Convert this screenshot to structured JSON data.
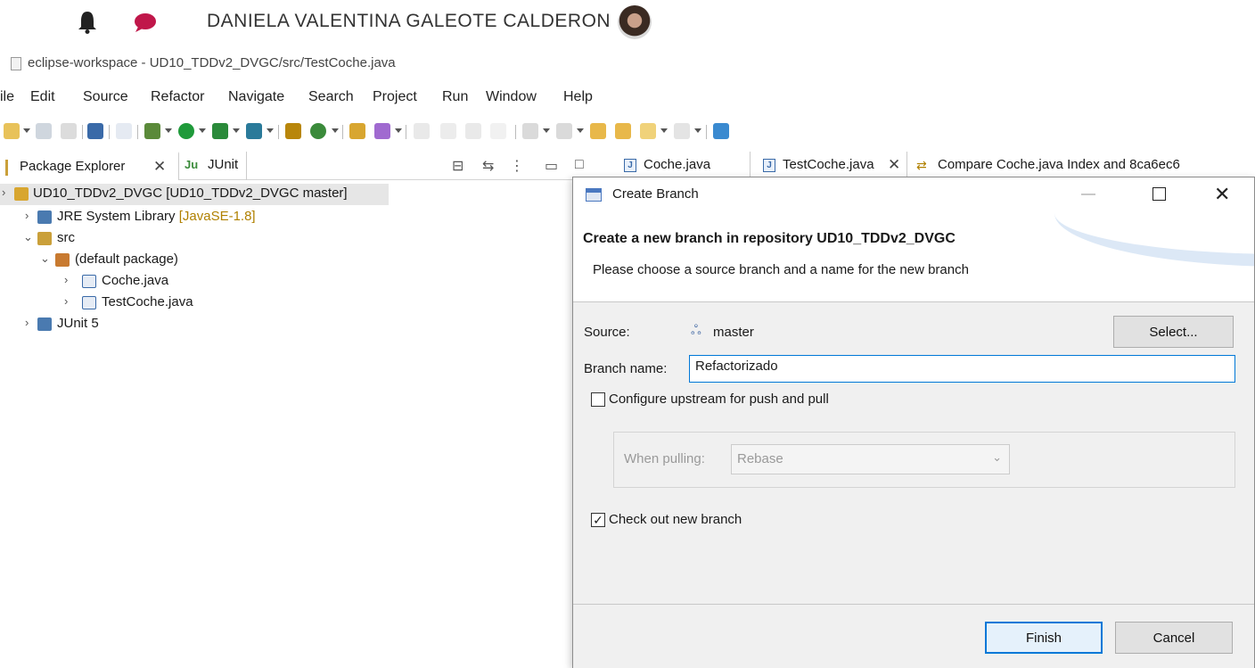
{
  "userbar": {
    "username": "DANIELA VALENTINA GALEOTE CALDERON"
  },
  "window": {
    "title": "eclipse-workspace - UD10_TDDv2_DVGC/src/TestCoche.java"
  },
  "menu": [
    "ile",
    "Edit",
    "Source",
    "Refactor",
    "Navigate",
    "Search",
    "Project",
    "Run",
    "Window",
    "Help"
  ],
  "left_view": {
    "tabs": {
      "package_explorer": "Package Explorer",
      "junit": "JUnit"
    },
    "tree": {
      "project": "UD10_TDDv2_DVGC [UD10_TDDv2_DVGC master]",
      "jre": "JRE System Library",
      "jre_version": "[JavaSE-1.8]",
      "src": "src",
      "default_package": "(default package)",
      "file1": "Coche.java",
      "file2": "TestCoche.java",
      "junit": "JUnit 5"
    }
  },
  "editor_tabs": [
    "Coche.java",
    "TestCoche.java",
    "Compare Coche.java Index and 8ca6ec6"
  ],
  "dialog": {
    "title": "Create Branch",
    "heading": "Create a new branch in repository UD10_TDDv2_DVGC",
    "subheading": "Please choose a source branch and a name for the new branch",
    "source_label": "Source:",
    "source_value": "master",
    "select_button": "Select...",
    "branch_name_label": "Branch name:",
    "branch_name_value": "Refactorizado",
    "configure_upstream": {
      "label": "Configure upstream for push and pull",
      "checked": false
    },
    "when_pulling_label": "When pulling:",
    "when_pulling_value": "Rebase",
    "checkout": {
      "label": "Check out new branch",
      "checked": true
    },
    "finish_button": "Finish",
    "cancel_button": "Cancel"
  }
}
